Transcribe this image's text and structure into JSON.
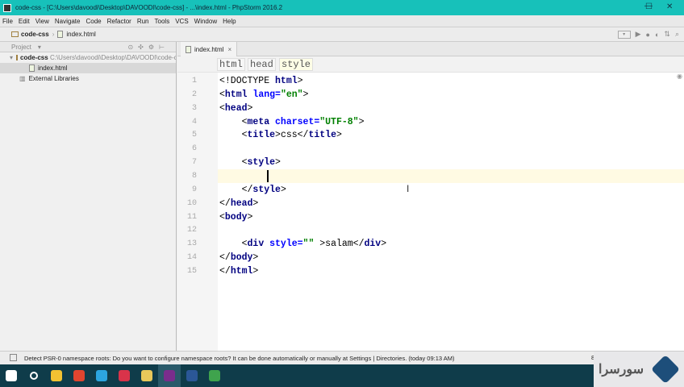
{
  "title": "code-css - [C:\\Users\\davoodi\\Desktop\\DAVOODI\\code-css] - ...\\index.html - PhpStorm 2016.2",
  "window_controls": {
    "minimize": "—",
    "maximize": "☐",
    "close": "✕"
  },
  "menu": [
    "File",
    "Edit",
    "View",
    "Navigate",
    "Code",
    "Refactor",
    "Run",
    "Tools",
    "VCS",
    "Window",
    "Help"
  ],
  "navbar": {
    "project": "code-css",
    "file": "index.html"
  },
  "sidebar": {
    "header": "Project",
    "root": "code-css",
    "root_path": "C:\\Users\\davoodi\\Desktop\\DAVOODI\\code-css",
    "file": "index.html",
    "libs": "External Libraries"
  },
  "editor_tab": {
    "label": "index.html",
    "close": "×"
  },
  "breadcrumbs": [
    "html",
    "head",
    "style"
  ],
  "code": [
    [
      [
        "br",
        "<!DOCTYPE "
      ],
      [
        "tag",
        "html"
      ],
      [
        "br",
        ">"
      ]
    ],
    [
      [
        "br",
        "<"
      ],
      [
        "tag",
        "html "
      ],
      [
        "attr",
        "lang="
      ],
      [
        "val",
        "\"en\""
      ],
      [
        "br",
        ">"
      ]
    ],
    [
      [
        "br",
        "<"
      ],
      [
        "tag",
        "head"
      ],
      [
        "br",
        ">"
      ]
    ],
    [
      [
        "txt",
        "    "
      ],
      [
        "br",
        "<"
      ],
      [
        "tag",
        "meta "
      ],
      [
        "attr",
        "charset="
      ],
      [
        "val",
        "\"UTF-8\""
      ],
      [
        "br",
        ">"
      ]
    ],
    [
      [
        "txt",
        "    "
      ],
      [
        "br",
        "<"
      ],
      [
        "tag",
        "title"
      ],
      [
        "br",
        ">"
      ],
      [
        "txt",
        "css"
      ],
      [
        "br",
        "</"
      ],
      [
        "tag",
        "title"
      ],
      [
        "br",
        ">"
      ]
    ],
    [],
    [
      [
        "txt",
        "    "
      ],
      [
        "br",
        "<"
      ],
      [
        "tag",
        "style"
      ],
      [
        "br",
        ">"
      ]
    ],
    [],
    [
      [
        "txt",
        "    "
      ],
      [
        "br",
        "</"
      ],
      [
        "tag",
        "style"
      ],
      [
        "br",
        ">"
      ]
    ],
    [
      [
        "br",
        "</"
      ],
      [
        "tag",
        "head"
      ],
      [
        "br",
        ">"
      ]
    ],
    [
      [
        "br",
        "<"
      ],
      [
        "tag",
        "body"
      ],
      [
        "br",
        ">"
      ]
    ],
    [],
    [
      [
        "txt",
        "    "
      ],
      [
        "br",
        "<"
      ],
      [
        "tag",
        "div "
      ],
      [
        "attr",
        "style="
      ],
      [
        "val",
        "\"\""
      ],
      [
        "txt",
        " >salam"
      ],
      [
        "br",
        "</"
      ],
      [
        "tag",
        "div"
      ],
      [
        "br",
        ">"
      ]
    ],
    [
      [
        "br",
        "</"
      ],
      [
        "tag",
        "body"
      ],
      [
        "br",
        ">"
      ]
    ],
    [
      [
        "br",
        "</"
      ],
      [
        "tag",
        "html"
      ],
      [
        "br",
        ">"
      ]
    ]
  ],
  "current_line": 8,
  "status": "Detect PSR-0 namespace roots: Do you want to configure namespace roots? It can be done automatically or manually at Settings | Directories. (today 09:13 AM)",
  "status_right": "8",
  "taskbar": [
    {
      "name": "start",
      "color": "#ffffff"
    },
    {
      "name": "search",
      "color": "#ffffff"
    },
    {
      "name": "file-explorer",
      "color": "#f2c232"
    },
    {
      "name": "chrome",
      "color": "#e0452f"
    },
    {
      "name": "telegram",
      "color": "#2ca5e0"
    },
    {
      "name": "dx",
      "color": "#d9334a"
    },
    {
      "name": "folder",
      "color": "#e8c85a"
    },
    {
      "name": "phpstorm",
      "color": "#7a2d8c"
    },
    {
      "name": "word",
      "color": "#2b5797"
    },
    {
      "name": "camtasia",
      "color": "#3fa34d"
    }
  ],
  "watermark": "سورسرا"
}
